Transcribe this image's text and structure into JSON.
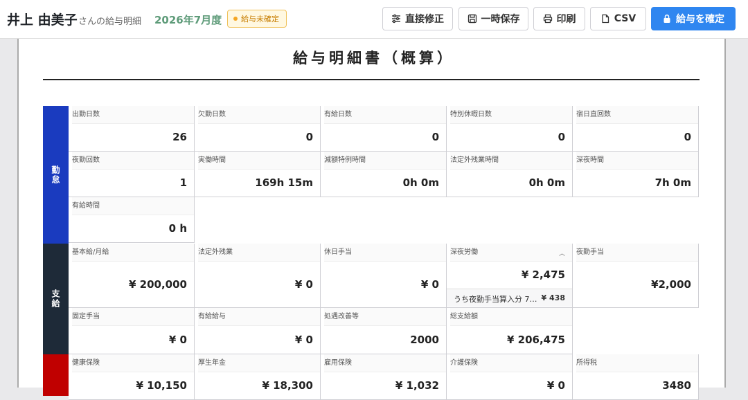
{
  "header": {
    "employee_name": "井上 由美子",
    "name_suffix": "さんの給与明細",
    "period": "2026年7月度",
    "status_badge": "給与未確定",
    "buttons": {
      "edit": "直接修正",
      "save": "一時保存",
      "print": "印刷",
      "csv": "CSV",
      "confirm": "給与を確定"
    }
  },
  "sheet": {
    "title": "給与明細書（概算）",
    "sections": {
      "attendance": "勤怠",
      "payment": "支給",
      "deduction": ""
    },
    "attendance": [
      {
        "label": "出勤日数",
        "value": "26"
      },
      {
        "label": "欠勤日数",
        "value": "0"
      },
      {
        "label": "有給日数",
        "value": "0"
      },
      {
        "label": "特別休暇日数",
        "value": "0"
      },
      {
        "label": "宿日直回数",
        "value": "0"
      },
      {
        "label": "夜勤回数",
        "value": "1"
      },
      {
        "label": "実働時間",
        "value": "169h 15m"
      },
      {
        "label": "減額特例時間",
        "value": "0h 0m"
      },
      {
        "label": "法定外残業時間",
        "value": "0h 0m"
      },
      {
        "label": "深夜時間",
        "value": "7h 0m"
      },
      {
        "label": "有給時間",
        "value": "0 h"
      }
    ],
    "payment": [
      {
        "label": "基本給/月給",
        "value": "¥ 200,000"
      },
      {
        "label": "法定外残業",
        "value": "¥ 0"
      },
      {
        "label": "休日手当",
        "value": "¥ 0"
      },
      {
        "label": "深夜労働",
        "value": "¥ 2,475",
        "sub_label": "うち夜勤手当算入分 7…",
        "sub_value": "¥ 438"
      },
      {
        "label": "夜勤手当",
        "value": "¥2,000"
      },
      {
        "label": "固定手当",
        "value": "¥ 0"
      },
      {
        "label": "有給給与",
        "value": "¥ 0"
      },
      {
        "label": "処遇改善等",
        "value": "2000"
      },
      {
        "label": "総支給額",
        "value": "¥ 206,475"
      }
    ],
    "deduction": [
      {
        "label": "健康保険",
        "value": "¥ 10,150"
      },
      {
        "label": "厚生年金",
        "value": "¥ 18,300"
      },
      {
        "label": "雇用保険",
        "value": "¥ 1,032"
      },
      {
        "label": "介護保険",
        "value": "¥ 0"
      },
      {
        "label": "所得税",
        "value": "3480"
      }
    ]
  },
  "colors": {
    "attendance": "#1a3bbf",
    "payment": "#1e2a38",
    "deduction": "#c00000",
    "primary": "#2f86f0"
  }
}
